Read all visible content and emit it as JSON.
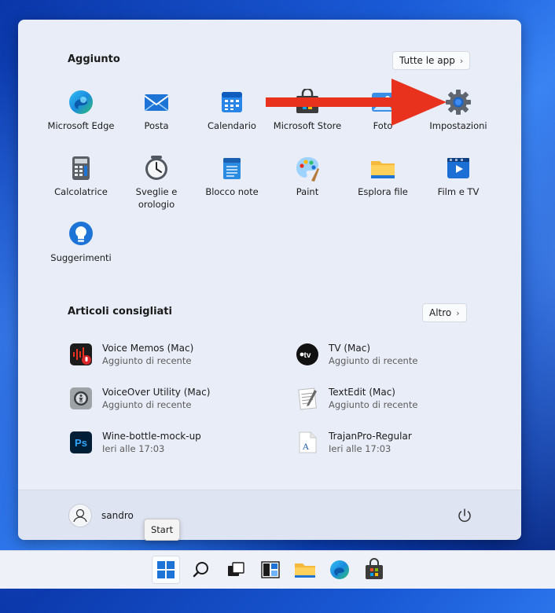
{
  "pinned": {
    "title": "Aggiunto",
    "all_apps_label": "Tutte le app",
    "apps": [
      {
        "label": "Microsoft Edge",
        "icon": "edge-icon"
      },
      {
        "label": "Posta",
        "icon": "mail-icon"
      },
      {
        "label": "Calendario",
        "icon": "calendar-icon"
      },
      {
        "label": "Microsoft Store",
        "icon": "store-icon"
      },
      {
        "label": "Foto",
        "icon": "photos-icon"
      },
      {
        "label": "Impostazioni",
        "icon": "settings-icon"
      },
      {
        "label": "Calcolatrice",
        "icon": "calculator-icon"
      },
      {
        "label": "Sveglie e orologio",
        "icon": "clock-icon"
      },
      {
        "label": "Blocco note",
        "icon": "notepad-icon"
      },
      {
        "label": "Paint",
        "icon": "paint-icon"
      },
      {
        "label": "Esplora file",
        "icon": "folder-icon"
      },
      {
        "label": "Film e TV",
        "icon": "movies-icon"
      },
      {
        "label": "Suggerimenti",
        "icon": "tips-icon"
      }
    ]
  },
  "recommended": {
    "title": "Articoli consigliati",
    "more_label": "Altro",
    "items": [
      {
        "name": "Voice Memos (Mac)",
        "sub": "Aggiunto di recente",
        "icon": "voice-memos-icon"
      },
      {
        "name": "TV (Mac)",
        "sub": "Aggiunto di recente",
        "icon": "apple-tv-icon"
      },
      {
        "name": "VoiceOver Utility (Mac)",
        "sub": "Aggiunto di recente",
        "icon": "voiceover-icon"
      },
      {
        "name": "TextEdit (Mac)",
        "sub": "Aggiunto di recente",
        "icon": "textedit-icon"
      },
      {
        "name": "Wine-bottle-mock-up",
        "sub": "Ieri alle 17:03",
        "icon": "photoshop-icon"
      },
      {
        "name": "TrajanPro-Regular",
        "sub": "Ieri alle 17:03",
        "icon": "font-file-icon"
      }
    ]
  },
  "footer": {
    "username": "sandro",
    "tooltip": "Start"
  },
  "taskbar": {
    "items": [
      "start-icon",
      "search-icon",
      "task-view-icon",
      "widgets-icon",
      "file-explorer-icon",
      "edge-icon",
      "store-icon"
    ]
  },
  "colors": {
    "accent": "#0067c0",
    "arrow": "#e8321e"
  }
}
